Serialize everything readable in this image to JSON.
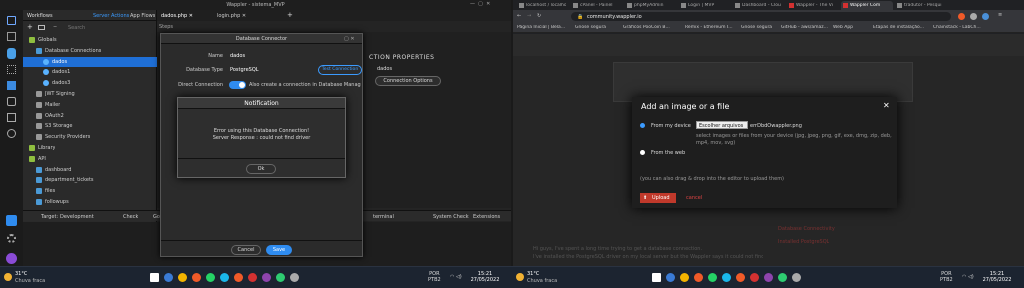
{
  "wappler": {
    "window_title": "Wappler - sistema_MVP",
    "tabs": [
      "dados.php",
      "login.php"
    ],
    "tab_plus": "+",
    "panel": {
      "tabs": [
        "Workflows",
        "Server Actions",
        "App Flows"
      ],
      "search_placeholder": "Search",
      "tree": [
        {
          "label": "Globals",
          "indent": 0,
          "type": "folder"
        },
        {
          "label": "Database Connections",
          "indent": 1,
          "type": "folder"
        },
        {
          "label": "dados",
          "indent": 2,
          "type": "db",
          "selected": true
        },
        {
          "label": "dados1",
          "indent": 2,
          "type": "db"
        },
        {
          "label": "dados3",
          "indent": 2,
          "type": "db"
        },
        {
          "label": "JWT Signing",
          "indent": 1,
          "type": "item"
        },
        {
          "label": "Mailer",
          "indent": 1,
          "type": "item"
        },
        {
          "label": "OAuth2",
          "indent": 1,
          "type": "item"
        },
        {
          "label": "S3 Storage",
          "indent": 1,
          "type": "item"
        },
        {
          "label": "Security Providers",
          "indent": 1,
          "type": "item"
        },
        {
          "label": "Library",
          "indent": 0,
          "type": "folder"
        },
        {
          "label": "API",
          "indent": 0,
          "type": "folder"
        },
        {
          "label": "dashboard",
          "indent": 1,
          "type": "folder"
        },
        {
          "label": "department_tickets",
          "indent": 1,
          "type": "folder"
        },
        {
          "label": "files",
          "indent": 1,
          "type": "folder"
        },
        {
          "label": "followups",
          "indent": 1,
          "type": "folder"
        },
        {
          "label": "integrations",
          "indent": 1,
          "type": "folder"
        }
      ]
    },
    "steps_label": "Steps",
    "properties_title": "CTION PROPERTIES",
    "properties_name": "dados",
    "connection_options": "Connection Options",
    "statusbar": {
      "target_label": "Target:",
      "target_value": "Development",
      "check": "Check",
      "go": "Go",
      "terminal": "terminal",
      "system_check": "System Check",
      "extensions": "Extensions",
      "remote": "Remote",
      "globals": "Globals"
    },
    "db_connector": {
      "title": "Database Connector",
      "name_label": "Name",
      "name_value": "dados",
      "type_label": "Database Type",
      "type_value": "PostgreSQL",
      "test_button": "Test Connection",
      "direct_label": "Direct Connection",
      "direct_desc": "Also create a connection in Database Manager",
      "cancel": "Cancel",
      "save": "Save"
    },
    "notification": {
      "title": "Notification",
      "line1": "Error using this Database Connection!",
      "line2": "Server Response : could not find driver",
      "ok": "Ok"
    }
  },
  "browser": {
    "tabs": [
      "localhost / localho",
      "cPanel - Painel",
      "phpMyAdmin",
      "Login | MVP",
      "Dashboard - Clou",
      "Wappler - The Vi",
      "Wappler Com",
      "tradutor - Pesqui"
    ],
    "url": "community.wappler.io",
    "bookmarks": [
      "Página Inicial | Bela...",
      "Gnose segura",
      "Gráficos PooCoin B...",
      "Remix - Ethereum I...",
      "Gnose segura",
      "GitHub - aws/amaz...",
      "Web App",
      "Etapas de instalação...",
      "Chainstack - LabCh..."
    ],
    "modal": {
      "title": "Add an image or a file",
      "close": "✕",
      "option_device": "From my device",
      "choose_button": "Escolher arquivos",
      "file_name": "errDbdOwappler.png",
      "help": "select images or files from your device (jpg, jpeg, png, gif, exe, dmg, zip, deb, mp4, mov, svg)",
      "option_web": "From the web",
      "drag_note": "(you can also drag & drop into the editor to upload them)",
      "upload": "Upload",
      "cancel": "cancel"
    },
    "bg_text": [
      "Hi guys, I've spent a long time trying to get a database connection.",
      "I've installed the PostgreSQL driver on my local server but the Wappler says it could not find driver",
      "Database Connectivity",
      "Installed PostgreSQL"
    ]
  },
  "taskbar": {
    "left": {
      "temp": "31°C",
      "weather": "Chuva fraca",
      "lang1": "POR",
      "lang2": "PTB2",
      "time": "15:21",
      "date": "27/05/2022"
    },
    "right": {
      "temp": "31°C",
      "weather": "Chuva fraca",
      "lang1": "POR",
      "lang2": "PTB2",
      "time": "15:21",
      "date": "27/05/2022"
    }
  },
  "colors": {
    "accent_blue": "#2f8cf0",
    "selected_tree": "#1f6fd6",
    "wappler_red": "#d33131",
    "upload_red": "#c0392b"
  }
}
